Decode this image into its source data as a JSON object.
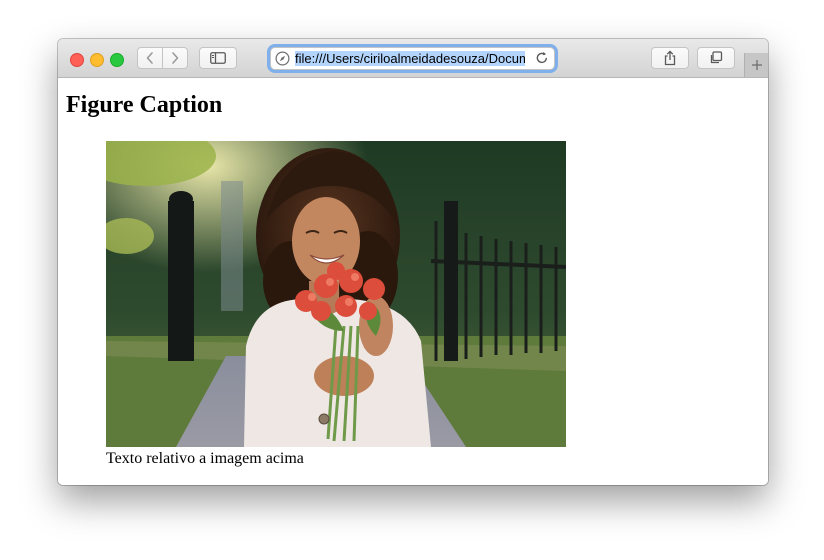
{
  "browser": {
    "url": "file:///Users/ciriloalmeidadesouza/Documents/figure.html",
    "icons": {
      "back": "chevron-left-icon",
      "forward": "chevron-right-icon",
      "sidebar": "sidebar-icon",
      "site": "compass-icon",
      "reload": "reload-icon",
      "share": "share-icon",
      "tabs": "tabs-overview-icon",
      "new_tab": "plus-icon"
    }
  },
  "page": {
    "heading": "Figure Caption",
    "figure": {
      "image_content": "woman with curly hair smiling and holding red flowers",
      "caption": "Texto relativo a imagem acima"
    }
  }
}
